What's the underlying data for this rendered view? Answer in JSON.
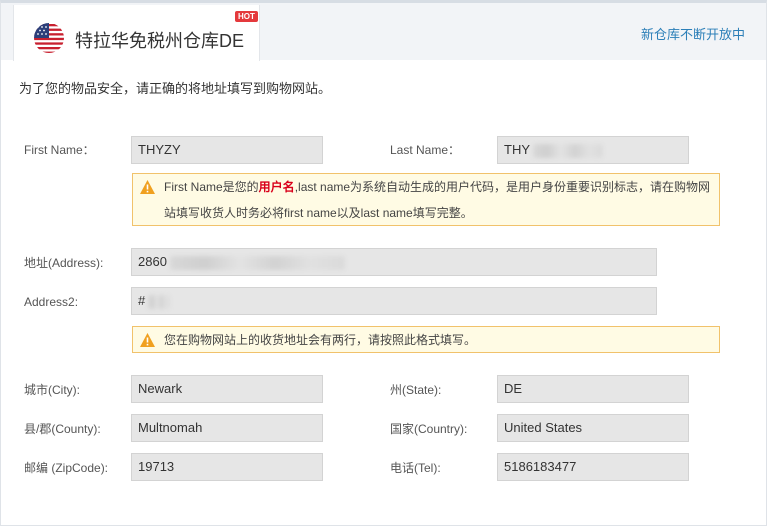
{
  "header": {
    "tab_title": "特拉华免税州仓库DE",
    "hot_badge": "HOT",
    "new_link": "新仓库不断开放中"
  },
  "intro": "为了您的物品安全，请正确的将地址填写到购物网站。",
  "fields": {
    "first_name": {
      "label": "First Name：",
      "value": "THYZY"
    },
    "last_name": {
      "label": "Last Name：",
      "value": "THY"
    },
    "address": {
      "label": "地址(Address):",
      "value": "2860"
    },
    "address2": {
      "label": "Address2:",
      "value": "#"
    },
    "city": {
      "label": "城市(City):",
      "value": "Newark"
    },
    "state": {
      "label": "州(State):",
      "value": "DE"
    },
    "county": {
      "label": "县/郡(County):",
      "value": "Multnomah"
    },
    "country": {
      "label": "国家(Country):",
      "value": "United States"
    },
    "zip": {
      "label": "邮编 (ZipCode):",
      "value": "19713"
    },
    "tel": {
      "label": "电话(Tel):",
      "value": "5186183477"
    }
  },
  "notice1": {
    "part1": "First Name是您的",
    "highlight": "用户名",
    "part2": ",last name为系统自动生成的用户代码，是用户身份重要识别标志，请在购物网站填写收货人时务必将first name以及last name填写完整。"
  },
  "notice2": {
    "text": "您在购物网站上的收货地址会有两行，请按照此格式填写。"
  },
  "colors": {
    "accent_link": "#2c7fb8",
    "highlight": "#d9001b",
    "notice_bg": "#fffbe4",
    "notice_border": "#f1c26b",
    "warning_icon": "#f0a020"
  },
  "icons": [
    "us-flag-icon",
    "warning-icon"
  ]
}
